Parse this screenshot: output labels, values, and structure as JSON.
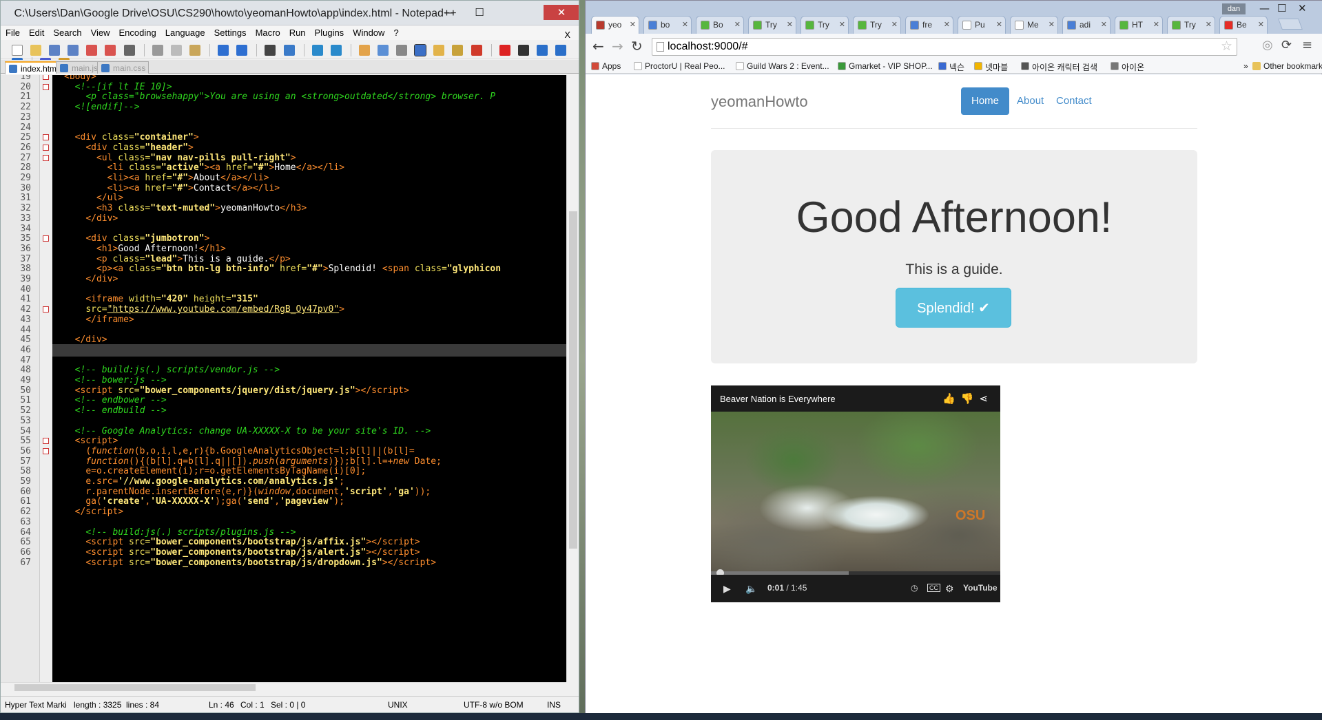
{
  "npp": {
    "title": "C:\\Users\\Dan\\Google Drive\\OSU\\CS290\\howto\\yeomanHowto\\app\\index.html - Notepad++",
    "window_buttons": {
      "minimize": "—",
      "maximize": "☐",
      "close": "✕"
    },
    "menu": [
      "File",
      "Edit",
      "Search",
      "View",
      "Encoding",
      "Language",
      "Settings",
      "Macro",
      "Run",
      "Plugins",
      "Window",
      "?"
    ],
    "menu_close": "X",
    "file_tabs": [
      {
        "label": "index.html",
        "active": true
      },
      {
        "label": "main.js",
        "active": false
      },
      {
        "label": "main.css",
        "active": false
      }
    ],
    "current_line": 46,
    "lines": [
      {
        "n": "19",
        "fold": true,
        "html": "<span class='t'>&lt;body&gt;</span>"
      },
      {
        "n": "20",
        "fold": true,
        "html": "  <span class='c'>&lt;!--[if lt IE 10]&gt;</span>"
      },
      {
        "n": "21",
        "fold": false,
        "html": "    <span class='c'>&lt;p class=\"browsehappy\"&gt;You are using an &lt;strong&gt;outdated&lt;/strong&gt; browser. P</span>"
      },
      {
        "n": "22",
        "fold": false,
        "html": "  <span class='c'>&lt;![endif]--&gt;</span>"
      },
      {
        "n": "23",
        "fold": false,
        "html": ""
      },
      {
        "n": "24",
        "fold": false,
        "html": ""
      },
      {
        "n": "25",
        "fold": true,
        "html": "  <span class='t'>&lt;div</span> <span class='a'>class=</span><span class='v'>\"container\"</span><span class='t'>&gt;</span>"
      },
      {
        "n": "26",
        "fold": true,
        "html": "    <span class='t'>&lt;div</span> <span class='a'>class=</span><span class='v'>\"header\"</span><span class='t'>&gt;</span>"
      },
      {
        "n": "27",
        "fold": true,
        "html": "      <span class='t'>&lt;ul</span> <span class='a'>class=</span><span class='v'>\"nav nav-pills pull-right\"</span><span class='t'>&gt;</span>"
      },
      {
        "n": "28",
        "fold": false,
        "html": "        <span class='t'>&lt;li</span> <span class='a'>class=</span><span class='v'>\"active\"</span><span class='t'>&gt;&lt;a</span> <span class='a'>href=</span><span class='v'>\"#\"</span><span class='t'>&gt;</span><span class='w'>Home</span><span class='t'>&lt;/a&gt;&lt;/li&gt;</span>"
      },
      {
        "n": "29",
        "fold": false,
        "html": "        <span class='t'>&lt;li&gt;&lt;a</span> <span class='a'>href=</span><span class='v'>\"#\"</span><span class='t'>&gt;</span><span class='w'>About</span><span class='t'>&lt;/a&gt;&lt;/li&gt;</span>"
      },
      {
        "n": "30",
        "fold": false,
        "html": "        <span class='t'>&lt;li&gt;&lt;a</span> <span class='a'>href=</span><span class='v'>\"#\"</span><span class='t'>&gt;</span><span class='w'>Contact</span><span class='t'>&lt;/a&gt;&lt;/li&gt;</span>"
      },
      {
        "n": "31",
        "fold": false,
        "html": "      <span class='t'>&lt;/ul&gt;</span>"
      },
      {
        "n": "32",
        "fold": false,
        "html": "      <span class='t'>&lt;h3</span> <span class='a'>class=</span><span class='v'>\"text-muted\"</span><span class='t'>&gt;</span><span class='w'>yeomanHowto</span><span class='t'>&lt;/h3&gt;</span>"
      },
      {
        "n": "33",
        "fold": false,
        "html": "    <span class='t'>&lt;/div&gt;</span>"
      },
      {
        "n": "34",
        "fold": false,
        "html": ""
      },
      {
        "n": "35",
        "fold": true,
        "html": "    <span class='t'>&lt;div</span> <span class='a'>class=</span><span class='v'>\"jumbotron\"</span><span class='t'>&gt;</span>"
      },
      {
        "n": "36",
        "fold": false,
        "html": "      <span class='t'>&lt;h1&gt;</span><span class='w'>Good Afternoon!</span><span class='t'>&lt;/h1&gt;</span>"
      },
      {
        "n": "37",
        "fold": false,
        "html": "      <span class='t'>&lt;p</span> <span class='a'>class=</span><span class='v'>\"lead\"</span><span class='t'>&gt;</span><span class='w'>This is a guide.</span><span class='t'>&lt;/p&gt;</span>"
      },
      {
        "n": "38",
        "fold": false,
        "html": "      <span class='t'>&lt;p&gt;&lt;a</span> <span class='a'>class=</span><span class='v'>\"btn btn-lg btn-info\"</span> <span class='a'>href=</span><span class='v'>\"#\"</span><span class='t'>&gt;</span><span class='w'>Splendid! </span><span class='t'>&lt;span</span> <span class='a'>class=</span><span class='v'>\"glyphicon</span>"
      },
      {
        "n": "39",
        "fold": false,
        "html": "    <span class='t'>&lt;/div&gt;</span>"
      },
      {
        "n": "40",
        "fold": false,
        "html": ""
      },
      {
        "n": "41",
        "fold": false,
        "html": "    <span class='t'>&lt;iframe</span> <span class='a'>width=</span><span class='v'>\"420\"</span> <span class='a'>height=</span><span class='v'>\"315\"</span>"
      },
      {
        "n": "42",
        "fold": true,
        "html": "    <span class='a'>src=</span><span class='u'>\"https://www.youtube.com/embed/RgB_Oy47pv0\"</span><span class='t'>&gt;</span>"
      },
      {
        "n": "43",
        "fold": false,
        "html": "    <span class='t'>&lt;/iframe&gt;</span>"
      },
      {
        "n": "44",
        "fold": false,
        "html": ""
      },
      {
        "n": "45",
        "fold": false,
        "html": "  <span class='t'>&lt;/div&gt;</span>"
      },
      {
        "n": "46",
        "fold": false,
        "html": ""
      },
      {
        "n": "47",
        "fold": false,
        "html": ""
      },
      {
        "n": "48",
        "fold": false,
        "html": "  <span class='c'>&lt;!-- build:js(.) scripts/vendor.js --&gt;</span>"
      },
      {
        "n": "49",
        "fold": false,
        "html": "  <span class='c'>&lt;!-- bower:js --&gt;</span>"
      },
      {
        "n": "50",
        "fold": false,
        "html": "  <span class='t'>&lt;script</span> <span class='a'>src=</span><span class='v'>\"bower_components/jquery/dist/jquery.js\"</span><span class='t'>&gt;&lt;/script&gt;</span>"
      },
      {
        "n": "51",
        "fold": false,
        "html": "  <span class='c'>&lt;!-- endbower --&gt;</span>"
      },
      {
        "n": "52",
        "fold": false,
        "html": "  <span class='c'>&lt;!-- endbuild --&gt;</span>"
      },
      {
        "n": "53",
        "fold": false,
        "html": ""
      },
      {
        "n": "54",
        "fold": false,
        "html": "  <span class='c'>&lt;!-- Google Analytics: change UA-XXXXX-X to be your site's ID. --&gt;</span>"
      },
      {
        "n": "55",
        "fold": true,
        "html": "  <span class='t'>&lt;script&gt;</span>"
      },
      {
        "n": "56",
        "fold": true,
        "html": "    <span class='k'>(<i>function</i>(b,o,i,l,e,r){b.GoogleAnalyticsObject=l;b[l]||(b[l]=</span>"
      },
      {
        "n": "57",
        "fold": false,
        "html": "    <span class='k'><i>function</i>(){(b[l].q=b[l].q||[]).<i>push</i>(<i>arguments</i>)});b[l].l=+<i>new</i> Date;</span>"
      },
      {
        "n": "58",
        "fold": false,
        "html": "    <span class='k'>e=o.createElement(i);r=o.getElementsByTagName(i)[0];</span>"
      },
      {
        "n": "59",
        "fold": false,
        "html": "    <span class='k'>e.src=</span><span class='v'>'//www.google-analytics.com/analytics.js'</span><span class='k'>;</span>"
      },
      {
        "n": "60",
        "fold": false,
        "html": "    <span class='k'>r.parentNode.insertBefore(e,r)}(<i>window</i>,document,</span><span class='v'>'script'</span><span class='k'>,</span><span class='v'>'ga'</span><span class='k'>));</span>"
      },
      {
        "n": "61",
        "fold": false,
        "html": "    <span class='k'>ga(</span><span class='v'>'create'</span><span class='k'>,</span><span class='v'>'UA-XXXXX-X'</span><span class='k'>);ga(</span><span class='v'>'send'</span><span class='k'>,</span><span class='v'>'pageview'</span><span class='k'>);</span>"
      },
      {
        "n": "62",
        "fold": false,
        "html": "  <span class='t'>&lt;/script&gt;</span>"
      },
      {
        "n": "63",
        "fold": false,
        "html": ""
      },
      {
        "n": "64",
        "fold": false,
        "html": "    <span class='c'>&lt;!-- build:js(.) scripts/plugins.js --&gt;</span>"
      },
      {
        "n": "65",
        "fold": false,
        "html": "    <span class='t'>&lt;script</span> <span class='a'>src=</span><span class='v'>\"bower_components/bootstrap/js/affix.js\"</span><span class='t'>&gt;&lt;/script&gt;</span>"
      },
      {
        "n": "66",
        "fold": false,
        "html": "    <span class='t'>&lt;script</span> <span class='a'>src=</span><span class='v'>\"bower_components/bootstrap/js/alert.js\"</span><span class='t'>&gt;&lt;/script&gt;</span>"
      },
      {
        "n": "67",
        "fold": false,
        "html": "    <span class='t'>&lt;script</span> <span class='a'>src=</span><span class='v'>\"bower_components/bootstrap/js/dropdown.js\"</span><span class='t'>&gt;&lt;/script&gt;</span>"
      }
    ],
    "status": {
      "lang": "Hyper Text Marki",
      "length": "length : 3325",
      "lines": "lines : 84",
      "pos": "Ln : 46",
      "col": "Col : 1",
      "sel": "Sel : 0 | 0",
      "eol": "UNIX",
      "enc": "UTF-8 w/o BOM",
      "mode": "INS"
    }
  },
  "chrome": {
    "user": "dan",
    "tabs": [
      {
        "label": "yeo",
        "color": "#b83a2e",
        "active": true
      },
      {
        "label": "bo",
        "color": "#4a7fd6",
        "active": false
      },
      {
        "label": "Bo",
        "color": "#57b63e",
        "active": false
      },
      {
        "label": "Try",
        "color": "#57b63e",
        "active": false
      },
      {
        "label": "Try",
        "color": "#57b63e",
        "active": false
      },
      {
        "label": "Try",
        "color": "#57b63e",
        "active": false
      },
      {
        "label": "fre",
        "color": "#4a7fd6",
        "active": false
      },
      {
        "label": "Pu",
        "color": "#ffffff",
        "active": false
      },
      {
        "label": "Me",
        "color": "#ffffff",
        "active": false
      },
      {
        "label": "adi",
        "color": "#4a7fd6",
        "active": false
      },
      {
        "label": "HT",
        "color": "#57b63e",
        "active": false
      },
      {
        "label": "Try",
        "color": "#57b63e",
        "active": false
      },
      {
        "label": "Be",
        "color": "#e52d27",
        "active": false
      }
    ],
    "tab_close": "✕",
    "url": "localhost:9000/#",
    "bookmarks": [
      {
        "label": "Apps",
        "color": "#d24a3a"
      },
      {
        "label": "ProctorU | Real Peo...",
        "color": "#ffffff"
      },
      {
        "label": "Guild Wars 2 : Event...",
        "color": "#ffffff"
      },
      {
        "label": "Gmarket - VIP SHOP...",
        "color": "#3a9a3a"
      },
      {
        "label": "넥슨",
        "color": "#3a6ad2"
      },
      {
        "label": "넷마블",
        "color": "#f2b500"
      },
      {
        "label": "아이온 캐릭터 검색",
        "color": "#555555"
      },
      {
        "label": "아이온",
        "color": "#777777"
      }
    ],
    "bookmarks_more": "»",
    "other_bookmarks": "Other bookmarks",
    "page": {
      "brand": "yeomanHowto",
      "nav": [
        {
          "label": "Home",
          "active": true
        },
        {
          "label": "About",
          "active": false
        },
        {
          "label": "Contact",
          "active": false
        }
      ],
      "heading": "Good Afternoon!",
      "lead": "This is a guide.",
      "button": "Splendid! ✔",
      "video": {
        "title": "Beaver Nation is Everywhere",
        "time_current": "0:01",
        "time_sep": " / ",
        "time_total": "1:45",
        "logo": "OSU",
        "brand": "YouTube",
        "progress": 0.01
      }
    }
  }
}
